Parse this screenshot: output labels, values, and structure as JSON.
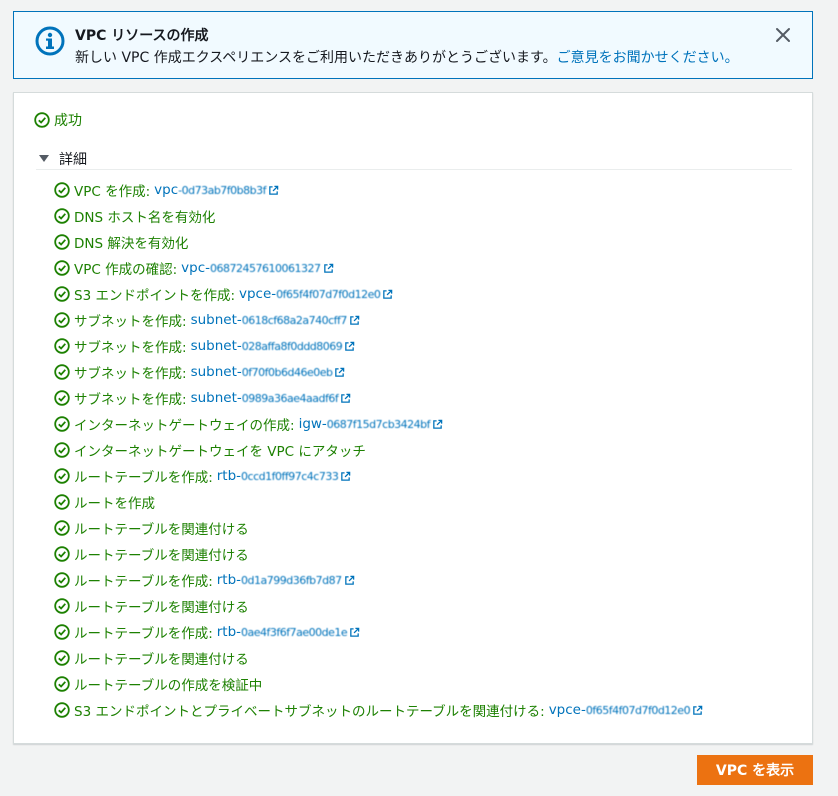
{
  "banner": {
    "title": "VPC リソースの作成",
    "message": "新しい VPC 作成エクスペリエンスをご利用いただきありがとうございます。",
    "feedback_link": "ご意見をお聞かせください。",
    "info_icon": "info-icon",
    "close_icon": "close-icon"
  },
  "status": {
    "label": "成功",
    "color": "#1d8102"
  },
  "details": {
    "label": "詳細",
    "steps": [
      {
        "label": "VPC を作成:",
        "res_prefix": "vpc",
        "res_id": "-0d73ab7f0b8b3f"
      },
      {
        "label": "DNS ホスト名を有効化",
        "res_prefix": "",
        "res_id": ""
      },
      {
        "label": "DNS 解決を有効化",
        "res_prefix": "",
        "res_id": ""
      },
      {
        "label": "VPC 作成の確認:",
        "res_prefix": "vpc-",
        "res_id": "06872457610061327"
      },
      {
        "label": "S3 エンドポイントを作成:",
        "res_prefix": "vpce-",
        "res_id": "0f65f4f07d7f0d12e0"
      },
      {
        "label": "サブネットを作成:",
        "res_prefix": "subnet-",
        "res_id": "0618cf68a2a740cff7"
      },
      {
        "label": "サブネットを作成:",
        "res_prefix": "subnet-",
        "res_id": "028affa8f0ddd8069"
      },
      {
        "label": "サブネットを作成:",
        "res_prefix": "subnet-",
        "res_id": "0f70f0b6d46e0eb"
      },
      {
        "label": "サブネットを作成:",
        "res_prefix": "subnet-",
        "res_id": "0989a36ae4aadf6f"
      },
      {
        "label": "インターネットゲートウェイの作成:",
        "res_prefix": "igw-",
        "res_id": "0687f15d7cb3424bf"
      },
      {
        "label": "インターネットゲートウェイを VPC にアタッチ",
        "res_prefix": "",
        "res_id": ""
      },
      {
        "label": "ルートテーブルを作成:",
        "res_prefix": "rtb-",
        "res_id": "0ccd1f0ff97c4c733"
      },
      {
        "label": "ルートを作成",
        "res_prefix": "",
        "res_id": ""
      },
      {
        "label": "ルートテーブルを関連付ける",
        "res_prefix": "",
        "res_id": ""
      },
      {
        "label": "ルートテーブルを関連付ける",
        "res_prefix": "",
        "res_id": ""
      },
      {
        "label": "ルートテーブルを作成:",
        "res_prefix": "rtb-",
        "res_id": "0d1a799d36fb7d87"
      },
      {
        "label": "ルートテーブルを関連付ける",
        "res_prefix": "",
        "res_id": ""
      },
      {
        "label": "ルートテーブルを作成:",
        "res_prefix": "rtb-",
        "res_id": "0ae4f3f6f7ae00de1e"
      },
      {
        "label": "ルートテーブルを関連付ける",
        "res_prefix": "",
        "res_id": ""
      },
      {
        "label": "ルートテーブルの作成を検証中",
        "res_prefix": "",
        "res_id": ""
      },
      {
        "label": "S3 エンドポイントとプライベートサブネットのルートテーブルを関連付ける:",
        "res_prefix": "vpce-",
        "res_id": "0f65f4f07d7f0d12e0"
      }
    ]
  },
  "actions": {
    "view_vpc": "VPC を表示"
  },
  "colors": {
    "link": "#0073bb",
    "success": "#1d8102",
    "primary_button": "#ec7211",
    "banner_border": "#0073bb"
  }
}
